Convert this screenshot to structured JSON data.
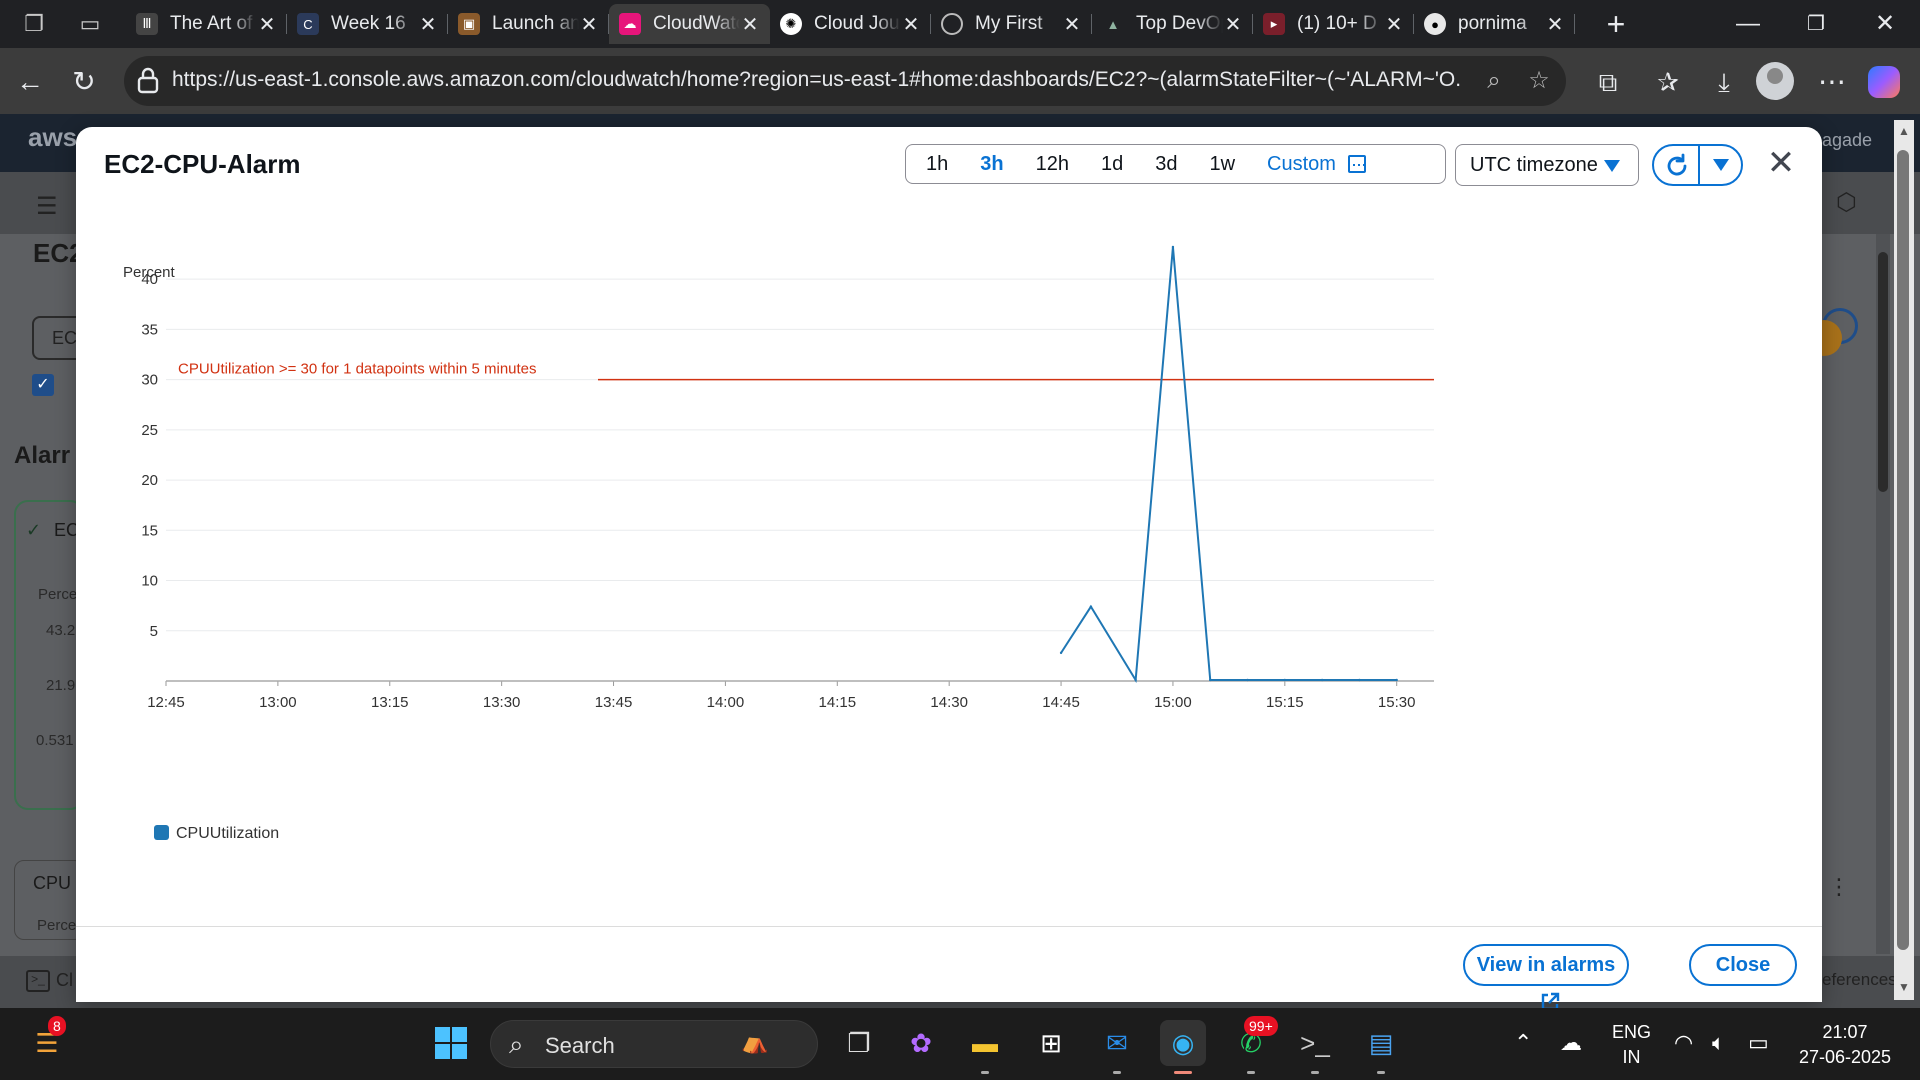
{
  "browser": {
    "tabs": [
      {
        "title": "The Art of",
        "active": false
      },
      {
        "title": "Week 16",
        "active": false
      },
      {
        "title": "Launch an",
        "active": false
      },
      {
        "title": "CloudWatch",
        "active": true
      },
      {
        "title": "Cloud Journey",
        "active": false
      },
      {
        "title": "My First",
        "active": false
      },
      {
        "title": "Top DevOps",
        "active": false
      },
      {
        "title": "(1) 10+ D",
        "active": false
      },
      {
        "title": "pornima",
        "active": false
      }
    ],
    "url": "https://us-east-1.console.aws.amazon.com/cloudwatch/home?region=us-east-1#home:dashboards/EC2?~(alarmStateFilter~(~'ALARM~'O..."
  },
  "background": {
    "aws_logo": "aws",
    "heading_fragment": "EC2",
    "search_fragment": "EC",
    "section_fragment": "Alarr",
    "card_title_fragment": "EC",
    "card_label_fragment": "Perce",
    "card_values": [
      "43.2",
      "21.9",
      "0.531"
    ],
    "cpu_fragment": "CPU",
    "bottom_label_fragment": "Perce",
    "cloudshell_fragment": "Cl",
    "upgrade_fragment": "agade",
    "preferences_fragment": "eferences"
  },
  "modal": {
    "title": "EC2-CPU-Alarm",
    "time_ranges": [
      "1h",
      "3h",
      "12h",
      "1d",
      "3d",
      "1w"
    ],
    "selected_range": "3h",
    "custom_label": "Custom",
    "timezone": "UTC timezone",
    "buttons": {
      "view_in_alarms": "View in alarms",
      "close": "Close"
    }
  },
  "chart_data": {
    "type": "line",
    "title": "",
    "ylabel": "Percent",
    "xlabel": "",
    "ylim": [
      0,
      43
    ],
    "yticks": [
      5,
      10,
      15,
      20,
      25,
      30,
      35,
      40
    ],
    "xticks": [
      "12:45",
      "13:00",
      "13:15",
      "13:30",
      "13:45",
      "14:00",
      "14:15",
      "14:30",
      "14:45",
      "15:00",
      "15:15",
      "15:30"
    ],
    "xrange_minutes": [
      765,
      935
    ],
    "series": [
      {
        "name": "CPUUtilization",
        "color": "#1f77b4",
        "x": [
          "14:45",
          "14:49",
          "14:55",
          "15:00",
          "15:05",
          "15:10",
          "15:15",
          "15:20",
          "15:25",
          "15:30"
        ],
        "y": [
          2.8,
          7.4,
          0.1,
          43.2,
          0.1,
          0.1,
          0.1,
          0.1,
          0.1,
          0.1
        ]
      }
    ],
    "threshold": {
      "value": 30,
      "label": "CPUUtilization >= 30 for 1 datapoints within 5 minutes",
      "color": "#d13212"
    },
    "grid": true,
    "legend": "bottom-left"
  },
  "taskbar": {
    "search_placeholder": "Search",
    "notification_badge": "8",
    "whatsapp_badge": "99+",
    "language": "ENG",
    "region": "IN",
    "time": "21:07",
    "date": "27-06-2025"
  }
}
